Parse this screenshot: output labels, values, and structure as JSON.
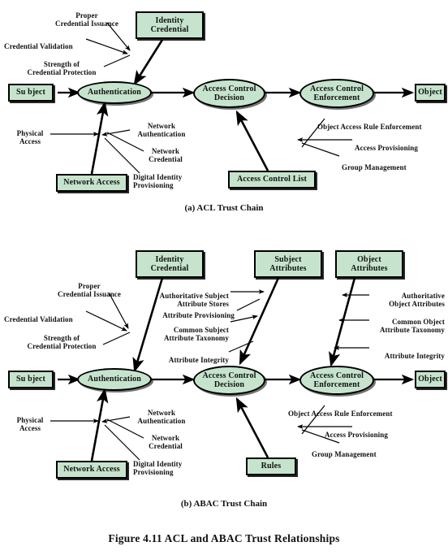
{
  "figure": {
    "caption": "Figure 4.11  ACL and ABAC Trust Relationships",
    "subcaption_a": "(a) ACL Trust Chain",
    "subcaption_b": "(b) ABAC Trust Chain",
    "node_fill": "#c6e4cd",
    "node_stroke": "#000000",
    "text_color": "#111111"
  },
  "acl": {
    "nodes": {
      "subject": "Su bject",
      "authentication": "Authentication",
      "access_control_decision": "Access Control\nDecision",
      "access_control_enforcement": "Access Control\nEnforcement",
      "object": "Object",
      "identity_credential": "Identity\nCredential",
      "network_access": "Network Access",
      "access_control_list": "Access Control List"
    },
    "annotations": {
      "proper_credential_issuance": "Proper\nCredential Issuance",
      "credential_validation": "Credential Validation",
      "strength_of_credential_protection": "Strength of\nCredential Protection",
      "physical_access": "Physical\nAccess",
      "network_authentication": "Network\nAuthentication",
      "network_credential": "Network\nCredential",
      "digital_identity_provisioning": "Digital Identity\nProvisioning",
      "object_access_rule_enforcement": "Object Access Rule Enforcement",
      "access_provisioning": "Access Provisioning",
      "group_management": "Group Management"
    }
  },
  "abac": {
    "nodes": {
      "subject": "Su bject",
      "authentication": "Authentication",
      "access_control_decision": "Access Control\nDecision",
      "access_control_enforcement": "Access Control\nEnforcement",
      "object": "Object",
      "identity_credential": "Identity\nCredential",
      "subject_attributes": "Subject\nAttributes",
      "object_attributes": "Object\nAttributes",
      "network_access": "Network Access",
      "rules": "Rules"
    },
    "annotations": {
      "proper_credential_issuance": "Proper\nCredential Issuance",
      "credential_validation": "Credential Validation",
      "strength_of_credential_protection": "Strength of\nCredential Protection",
      "authoritative_subject_attribute_stores": "Authoritative Subject\nAttribute Stores",
      "attribute_provisioning": "Attribute Provisioning",
      "common_subject_attribute_taxonomy": "Common Subject\nAttribute Taxonomy",
      "attribute_integrity_subject": "Attribute Integrity",
      "authoritative_object_attributes": "Authoritative\nObject Attributes",
      "common_object_attribute_taxonomy": "Common Object\nAttribute Taxonomy",
      "attribute_integrity_object": "Attribute Integrity",
      "physical_access": "Physical\nAccess",
      "network_authentication": "Network\nAuthentication",
      "network_credential": "Network\nCredential",
      "digital_identity_provisioning": "Digital Identity\nProvisioning",
      "object_access_rule_enforcement": "Object Access Rule Enforcement",
      "access_provisioning": "Access Provisioning",
      "group_management": "Group Management"
    }
  }
}
